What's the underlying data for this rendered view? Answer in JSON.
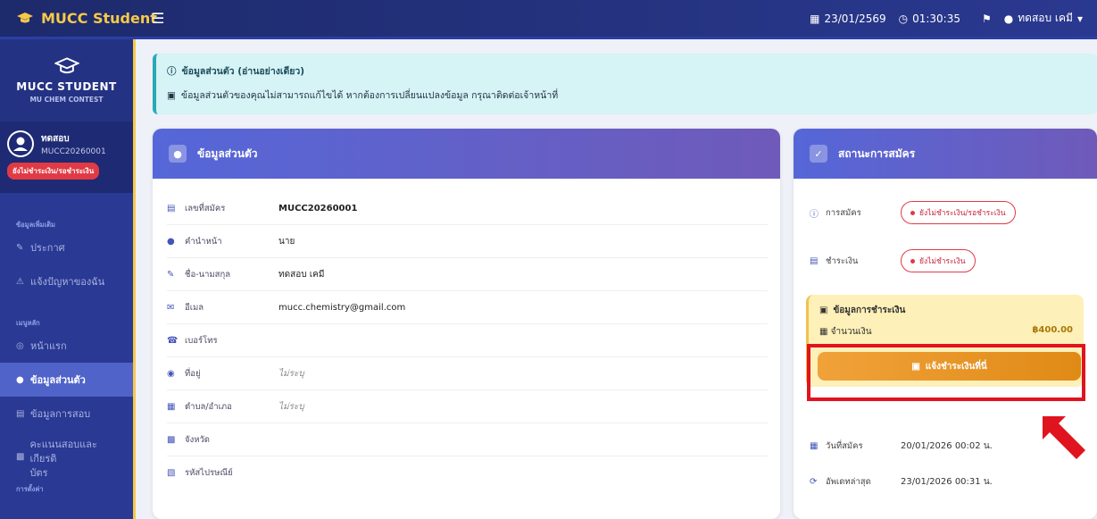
{
  "app": {
    "brand": "MUCC Student",
    "date": "23/01/2569",
    "time": "01:30:35",
    "username": "ทดสอบ เคมี"
  },
  "sidebar": {
    "logo_title": "MUCC STUDENT",
    "logo_sub": "MU CHEM CONTEST",
    "user_name": "ทดสอบ",
    "user_code": "MUCC20260001",
    "user_badge": "ยังไม่ชำระเงิน/รอชำระเงิน",
    "section1": "ข้อมูลเพิ่มเติม",
    "items1": [
      {
        "label": "ประกาศ"
      },
      {
        "label": "แจ้งปัญหาของฉัน"
      }
    ],
    "section2": "เมนูหลัก",
    "items2": [
      {
        "label": "หน้าแรก"
      },
      {
        "label": "ข้อมูลส่วนตัว"
      },
      {
        "label": "ข้อมูลการสอบ"
      },
      {
        "label": "คะแนนสอบและเกียรติ"
      },
      {
        "label": "บัตร"
      }
    ],
    "section3": "การตั้งค่า"
  },
  "alert": {
    "title": "ข้อมูลส่วนตัว (อ่านอย่างเดียว)",
    "body": "ข้อมูลส่วนตัวของคุณไม่สามารถแก้ไขได้ หากต้องการเปลี่ยนแปลงข้อมูล กรุณาติดต่อเจ้าหน้าที่"
  },
  "profile": {
    "title": "ข้อมูลส่วนตัว",
    "rows": [
      {
        "label": "เลขที่สมัคร",
        "value": "MUCC20260001"
      },
      {
        "label": "คำนำหน้า",
        "value": "นาย"
      },
      {
        "label": "ชื่อ-นามสกุล",
        "value": "ทดสอบ เคมี"
      },
      {
        "label": "อีเมล",
        "value": "mucc.chemistry@gmail.com"
      },
      {
        "label": "เบอร์โทร",
        "value": ""
      },
      {
        "label": "ที่อยู่",
        "value": "ไม่ระบุ"
      },
      {
        "label": "ตำบล/อำเภอ",
        "value": "ไม่ระบุ"
      },
      {
        "label": "จังหวัด",
        "value": ""
      },
      {
        "label": "รหัสไปรษณีย์",
        "value": ""
      }
    ]
  },
  "status": {
    "title": "สถานะการสมัคร",
    "reg_label": "การสมัคร",
    "reg_value": "ยังไม่ชำระเงิน/รอชำระเงิน",
    "pay_label": "ชำระเงิน",
    "pay_value": "ยังไม่ชำระเงิน",
    "pay_info_title": "ข้อมูลการชำระเงิน",
    "amount_label": "จำนวนเงิน",
    "amount_value": "฿400.00",
    "pay_button": "แจ้งชำระเงินที่นี่",
    "applied_label": "วันที่สมัคร",
    "applied_value": "20/01/2026 00:02 น.",
    "updated_label": "อัพเดทล่าสุด",
    "updated_value": "23/01/2026 00:31 น."
  },
  "colors": {
    "accent": "#2a3993",
    "highlight": "#e0141e",
    "badge": "#e03a45"
  }
}
